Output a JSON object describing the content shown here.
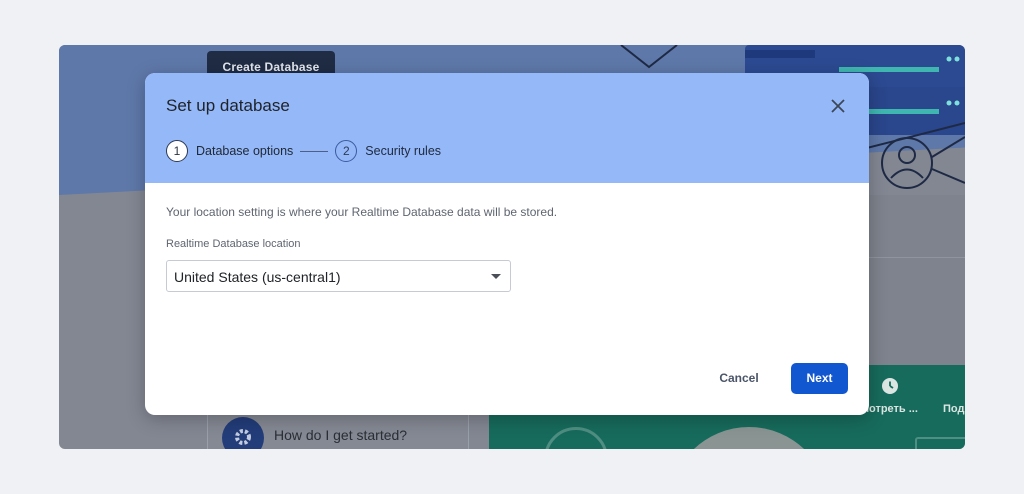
{
  "background": {
    "create_database_label": "Create Database",
    "help_card_text": "How do I get started?",
    "watch_label": "мотреть ...",
    "pod_label": "Под"
  },
  "dialog": {
    "title": "Set up database",
    "close_icon": "close-icon",
    "steps": [
      {
        "number": "1",
        "label": "Database options",
        "state": "active"
      },
      {
        "number": "2",
        "label": "Security rules",
        "state": "inactive"
      }
    ],
    "info_text": "Your location setting is where your Realtime Database data will be stored.",
    "location_field": {
      "label": "Realtime Database location",
      "value": "United States (us-central1)"
    },
    "cancel_label": "Cancel",
    "next_label": "Next"
  },
  "colors": {
    "header_bg": "#94b8f8",
    "primary_button": "#1157d0",
    "page_bg": "#eff1f5"
  }
}
